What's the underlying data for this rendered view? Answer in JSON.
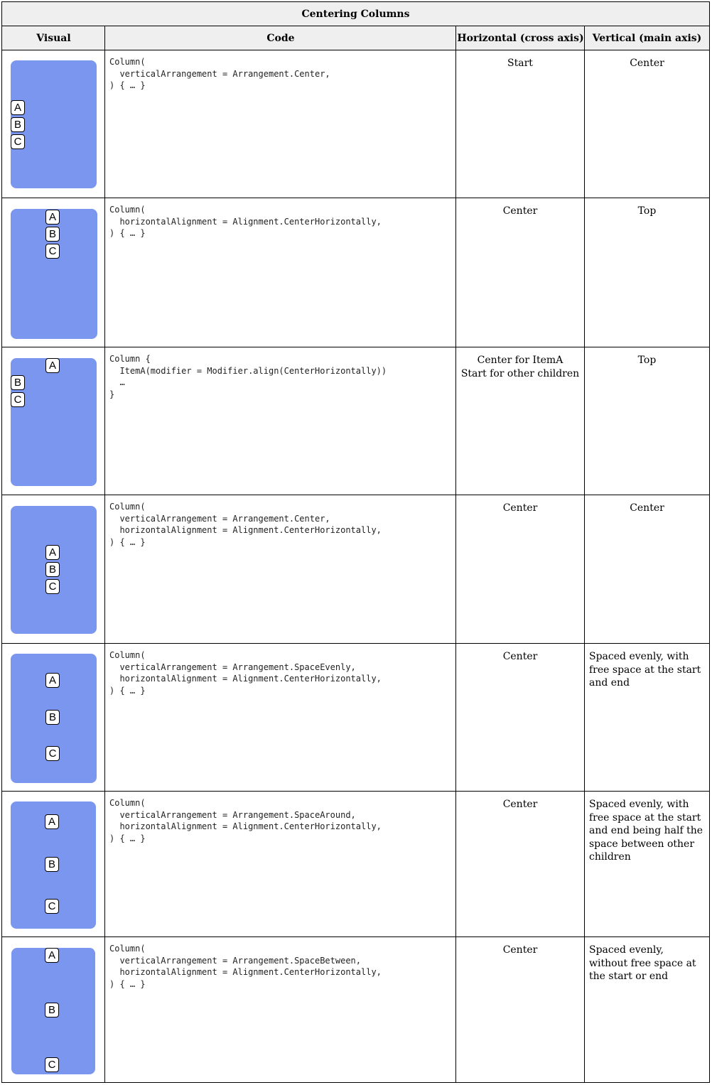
{
  "title": "Centering Columns",
  "headers": {
    "visual": "Visual",
    "code": "Code",
    "horizontal": "Horizontal (cross axis)",
    "vertical": "Vertical (main axis)"
  },
  "phone_color": "#7a96ee",
  "rows": [
    {
      "code": "Column(\n  verticalArrangement = Arrangement.Center,\n) { … }",
      "horizontal": "Start",
      "vertical": "Center",
      "items": [
        "A",
        "B",
        "C"
      ]
    },
    {
      "code": "Column(\n  horizontalAlignment = Alignment.CenterHorizontally,\n) { … }",
      "horizontal": "Center",
      "vertical": "Top",
      "items": [
        "A",
        "B",
        "C"
      ]
    },
    {
      "code": "Column {\n  ItemA(modifier = Modifier.align(CenterHorizontally))\n  …\n}",
      "horizontal": "Center for ItemA\nStart for other children",
      "vertical": "Top",
      "items": [
        "A",
        "B",
        "C"
      ]
    },
    {
      "code": "Column(\n  verticalArrangement = Arrangement.Center,\n  horizontalAlignment = Alignment.CenterHorizontally,\n) { … }",
      "horizontal": "Center",
      "vertical": "Center",
      "items": [
        "A",
        "B",
        "C"
      ]
    },
    {
      "code": "Column(\n  verticalArrangement = Arrangement.SpaceEvenly,\n  horizontalAlignment = Alignment.CenterHorizontally,\n) { … }",
      "horizontal": "Center",
      "vertical": "Spaced evenly, with free space at the start and end",
      "items": [
        "A",
        "B",
        "C"
      ]
    },
    {
      "code": "Column(\n  verticalArrangement = Arrangement.SpaceAround,\n  horizontalAlignment = Alignment.CenterHorizontally,\n) { … }",
      "horizontal": "Center",
      "vertical": "Spaced evenly, with free space at the start and end being half the space between other children",
      "items": [
        "A",
        "B",
        "C"
      ]
    },
    {
      "code": "Column(\n  verticalArrangement = Arrangement.SpaceBetween,\n  horizontalAlignment = Alignment.CenterHorizontally,\n) { … }",
      "horizontal": "Center",
      "vertical": "Spaced evenly, without free space at the start or end",
      "items": [
        "A",
        "B",
        "C"
      ]
    }
  ]
}
